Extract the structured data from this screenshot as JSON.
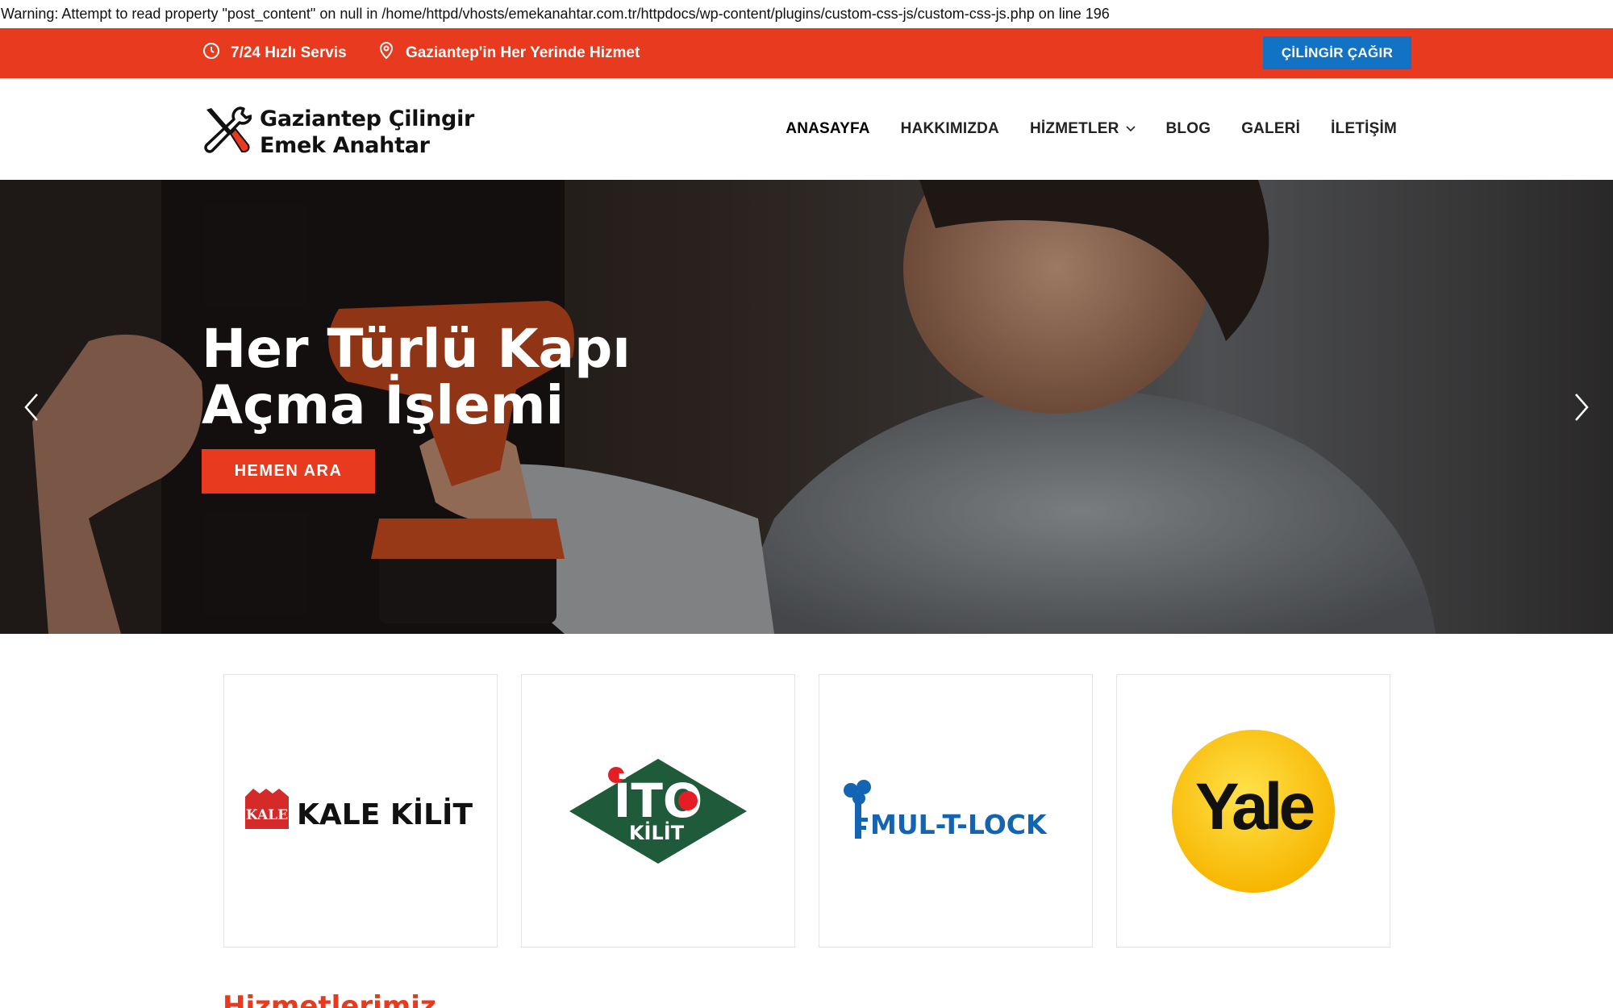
{
  "warning": {
    "text": "Warning: Attempt to read property \"post_content\" on null in /home/httpd/vhosts/emekanahtar.com.tr/httpdocs/wp-content/plugins/custom-css-js/custom-css-js.php on line 196"
  },
  "topbar": {
    "service_text": "7/24 Hızlı Servis",
    "location_text": "Gaziantep'in Her Yerinde Hizmet",
    "call_button": "ÇİLİNGİR ÇAĞIR",
    "background_color": "#e73a1e",
    "button_color": "#1273c4"
  },
  "logo": {
    "line1": "Gaziantep Çilingir",
    "line2": "Emek Anahtar",
    "icon": "crossed-tools-icon"
  },
  "nav": {
    "items": [
      {
        "label": "ANASAYFA"
      },
      {
        "label": "HAKKIMIZDA"
      },
      {
        "label": "HİZMETLER"
      },
      {
        "label": "BLOG"
      },
      {
        "label": "GALERİ"
      },
      {
        "label": "İLETİŞİM"
      }
    ]
  },
  "hero": {
    "title_line1": "Her Türlü Kapı",
    "title_line2": "Açma İşlemi",
    "button": "HEMEN ARA",
    "prev_icon": "chevron-left-icon",
    "next_icon": "chevron-right-icon"
  },
  "brands": [
    {
      "name": "kale-kilit-logo",
      "text": "KALE KİLİT",
      "badge": "KALE"
    },
    {
      "name": "ito-kilit-logo",
      "text_top": "İTO",
      "text_bottom": "KİLİT"
    },
    {
      "name": "mul-t-lock-logo",
      "text": "MUL-T-LOCK"
    },
    {
      "name": "yale-logo",
      "text": "Yale"
    }
  ],
  "section": {
    "title": "Hizmetlerimiz"
  },
  "colors": {
    "accent": "#e73a1e",
    "blue": "#1273c4",
    "ito_green": "#1f5a3a",
    "mul_t_lock_blue": "#1464b4",
    "yale_yellow": "#ffd200"
  }
}
